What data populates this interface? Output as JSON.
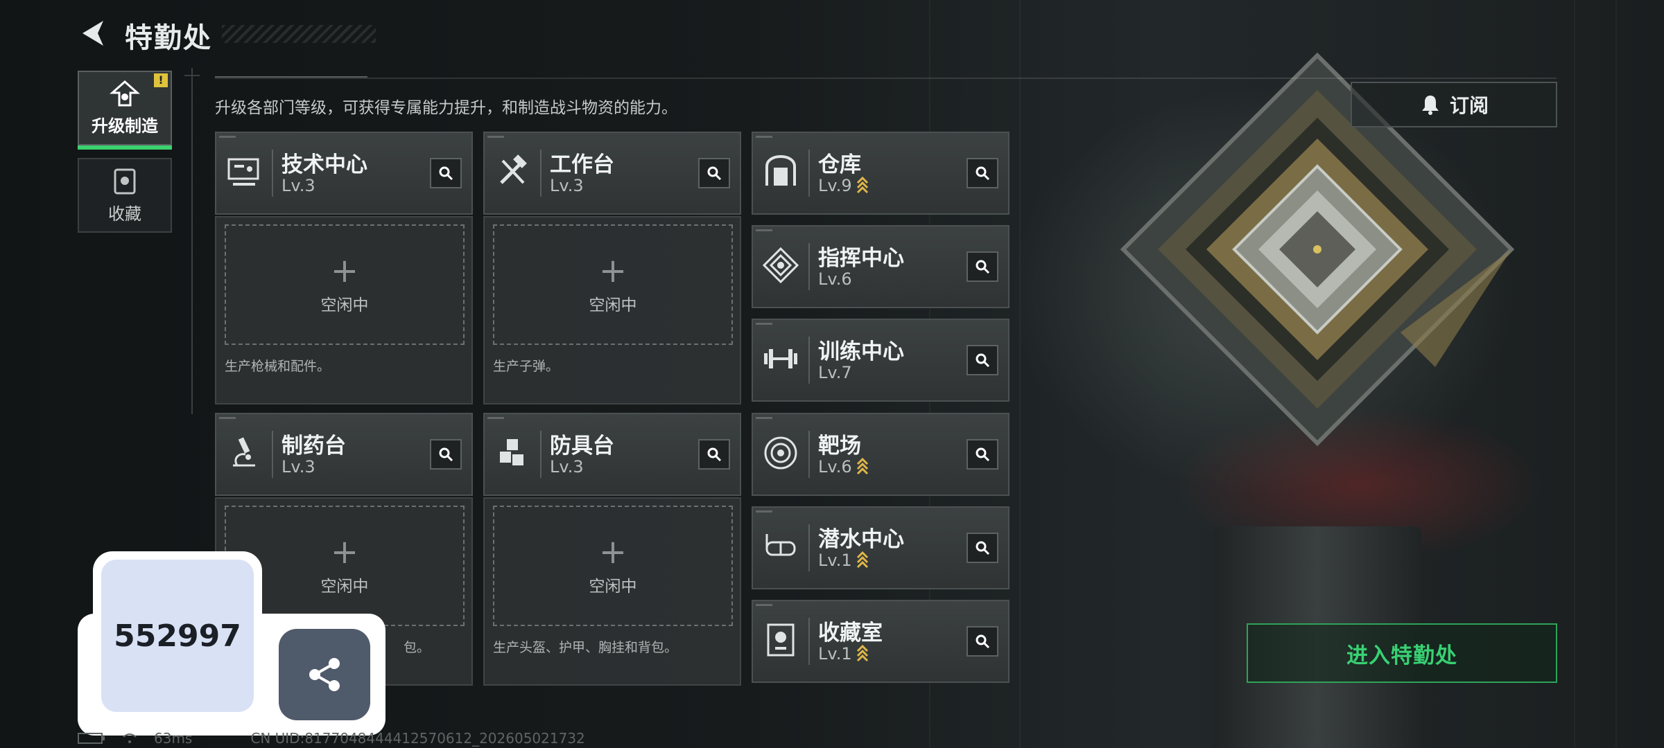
{
  "header": {
    "title": "特勤处"
  },
  "tabs": [
    {
      "label": "升级制造",
      "active": true,
      "badge": "!"
    },
    {
      "label": "收藏",
      "active": false
    }
  ],
  "description": "升级各部门等级，可获得专属能力提升，和制造战斗物资的能力。",
  "subscribe": {
    "label": "订阅"
  },
  "departments": {
    "tech": {
      "name": "技术中心",
      "level": "Lv.3",
      "icon": "monitor-icon"
    },
    "workbench": {
      "name": "工作台",
      "level": "Lv.3",
      "icon": "hammer-wrench-icon"
    },
    "pharmacy": {
      "name": "制药台",
      "level": "Lv.3",
      "icon": "microscope-icon"
    },
    "armor": {
      "name": "防具台",
      "level": "Lv.3",
      "icon": "blocks-icon"
    },
    "warehouse": {
      "name": "仓库",
      "level": "Lv.9",
      "upgradable": true,
      "icon": "vault-icon"
    },
    "command": {
      "name": "指挥中心",
      "level": "Lv.6",
      "icon": "emblem-icon"
    },
    "training": {
      "name": "训练中心",
      "level": "Lv.7",
      "icon": "dumbbell-icon"
    },
    "range": {
      "name": "靶场",
      "level": "Lv.6",
      "upgradable": true,
      "icon": "target-icon"
    },
    "diving": {
      "name": "潜水中心",
      "level": "Lv.1",
      "upgradable": true,
      "icon": "goggles-icon"
    },
    "collection": {
      "name": "收藏室",
      "level": "Lv.1",
      "upgradable": true,
      "icon": "trophy-case-icon"
    }
  },
  "slots": {
    "tech": {
      "status": "空闲中",
      "desc": "生产枪械和配件。"
    },
    "workbench": {
      "status": "空闲中",
      "desc": "生产子弹。"
    },
    "pharmacy": {
      "status": "空闲中",
      "desc": "生产药品和背包。",
      "visible_desc": "包。"
    },
    "armor": {
      "status": "空闲中",
      "desc": "生产头盔、护甲、胸挂和背包。"
    }
  },
  "enter_button": {
    "label": "进入特勤处"
  },
  "overlay": {
    "code": "552997",
    "share_icon": "share-icon"
  },
  "status_bar": {
    "ping": "63ms",
    "uid": "CN UID:8177048444412570612_202605021732"
  },
  "colors": {
    "accent_green": "#38d173",
    "upgrade_gold": "#e0b64a",
    "badge_yellow": "#e0c33c"
  }
}
